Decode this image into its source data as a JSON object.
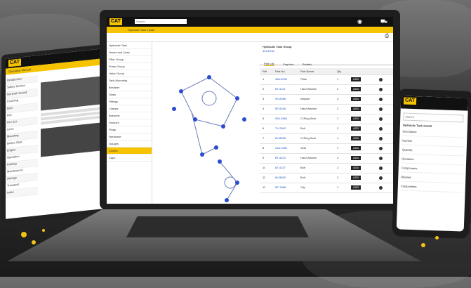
{
  "brand": {
    "logo": "CAT",
    "accent": "#f5c300"
  },
  "laptop": {
    "title": "Hydraulic Tank Install",
    "search_placeholder": "Search",
    "tabs": [
      "Part List",
      "Graphics",
      "Related"
    ],
    "part_header": "Hydraulic Tank Group",
    "part_number": "423-6742",
    "columns": [
      "Ref",
      "Part No.",
      "Part Name",
      "Qty"
    ],
    "rows": [
      {
        "ref": "1",
        "part": "465-5030",
        "name": "Plate",
        "qty": "1"
      },
      {
        "ref": "2",
        "part": "8T-4121",
        "name": "Hard Washer",
        "qty": "2"
      },
      {
        "ref": "3",
        "part": "9X-8256",
        "name": "Washer",
        "qty": "4"
      },
      {
        "ref": "4",
        "part": "5P-8245",
        "name": "Hard Washer",
        "qty": "2"
      },
      {
        "ref": "5",
        "part": "095-1566",
        "name": "O-Ring Seal",
        "qty": "1"
      },
      {
        "ref": "6",
        "part": "7X-2542",
        "name": "Bolt",
        "qty": "2"
      },
      {
        "ref": "7",
        "part": "6V-8398",
        "name": "O-Ring Seal",
        "qty": "1"
      },
      {
        "ref": "8",
        "part": "228-7089",
        "name": "Seal",
        "qty": "1"
      },
      {
        "ref": "9",
        "part": "8T-4223",
        "name": "Hard Washer",
        "qty": "4"
      },
      {
        "ref": "10",
        "part": "8T-4137",
        "name": "Bolt",
        "qty": "2"
      },
      {
        "ref": "11",
        "part": "6V-5839",
        "name": "Bolt",
        "qty": "2"
      },
      {
        "ref": "12",
        "part": "5P-7658",
        "name": "Clip",
        "qty": "1"
      }
    ],
    "add_label": "ADD",
    "sidebar": [
      "Hydraulic Tank",
      "Hoses and Lines",
      "Filter Group",
      "Pump Group",
      "Valve Group",
      "Tank Mounting",
      "Breather",
      "Seals",
      "Fittings",
      "Clamps",
      "Brackets",
      "Sensors",
      "Plugs",
      "Hardware",
      "Gauges",
      "Covers",
      "Caps"
    ]
  },
  "tablet": {
    "title": "Operation Manual",
    "sidebar": [
      "Introduction",
      "Safety Section",
      "General Hazard",
      "Crushing",
      "Burn",
      "Fire",
      "Fire Ext.",
      "Lines",
      "Mounting",
      "Before Start",
      "Engine",
      "Operation",
      "Parking",
      "Maintenance",
      "Storage",
      "Transport",
      "Index"
    ]
  },
  "phone": {
    "search_placeholder": "Search",
    "title": "Hydraulic Tank Install",
    "lines": [
      "Description",
      "Number",
      "Quantity",
      "Operation",
      "Components",
      "Related",
      "Components"
    ]
  }
}
